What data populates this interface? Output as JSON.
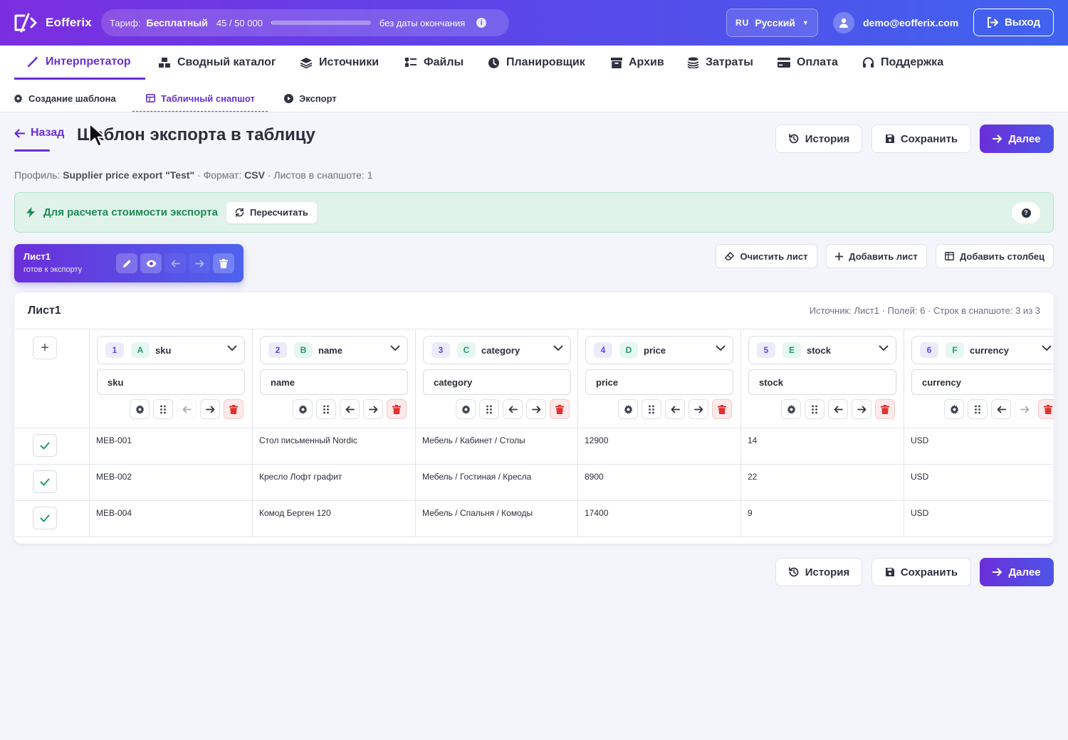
{
  "app": {
    "name": "Eofferix",
    "tariff_label": "Тариф:",
    "tariff_plan": "Бесплатный",
    "tariff_quota": "45 / 50 000",
    "tariff_usage_fraction": 0.0009,
    "tariff_expiry": "без даты окончания",
    "lang_code": "RU",
    "lang_name": "Русский",
    "user_email": "demo@eofferix.com",
    "logout": "Выход"
  },
  "nav": {
    "items": [
      {
        "label": "Интерпретатор",
        "icon": "magic-wand-icon"
      },
      {
        "label": "Сводный каталог",
        "icon": "boxes-icon"
      },
      {
        "label": "Источники",
        "icon": "layers-icon"
      },
      {
        "label": "Файлы",
        "icon": "files-icon"
      },
      {
        "label": "Планировщик",
        "icon": "clock-icon"
      },
      {
        "label": "Архив",
        "icon": "archive-icon"
      },
      {
        "label": "Затраты",
        "icon": "coins-icon"
      },
      {
        "label": "Оплата",
        "icon": "credit-card-icon"
      },
      {
        "label": "Поддержка",
        "icon": "headset-icon"
      }
    ],
    "active_index": 0,
    "sub": [
      {
        "label": "Создание шаблона",
        "icon": "gear-icon"
      },
      {
        "label": "Табличный снапшот",
        "icon": "table-icon"
      },
      {
        "label": "Экспорт",
        "icon": "play-circle-icon"
      }
    ],
    "active_sub_index": 1
  },
  "page": {
    "back": "Назад",
    "title": "Шаблон экспорта в таблицу",
    "history": "История",
    "save": "Сохранить",
    "next": "Далее",
    "meta_profile_label": "Профиль:",
    "meta_profile": "Supplier price export \"Test\"",
    "meta_format_label": "· Формат:",
    "meta_format": "CSV",
    "meta_sheets": "· Листов в снапшоте: 1"
  },
  "alert": {
    "text": "Для расчета стоимости экспорта",
    "recalc": "Пересчитать",
    "color": "#1f8a55"
  },
  "sheet_tab": {
    "name": "Лист1",
    "status": "готов к экспорту"
  },
  "sheet_actions": {
    "clear": "Очистить лист",
    "add_sheet": "Добавить лист",
    "add_column": "Добавить столбец"
  },
  "table": {
    "title": "Лист1",
    "meta": "Источник: Лист1 · Полей: 6 · Строк в снапшоте: 3 из 3",
    "columns": [
      {
        "num": "1",
        "letter": "A",
        "field": "sku",
        "header": "sku"
      },
      {
        "num": "2",
        "letter": "B",
        "field": "name",
        "header": "name"
      },
      {
        "num": "3",
        "letter": "C",
        "field": "category",
        "header": "category"
      },
      {
        "num": "4",
        "letter": "D",
        "field": "price",
        "header": "price"
      },
      {
        "num": "5",
        "letter": "E",
        "field": "stock",
        "header": "stock"
      },
      {
        "num": "6",
        "letter": "F",
        "field": "currency",
        "header": "currency"
      }
    ],
    "rows": [
      [
        "MEB-001",
        "Стол письменный Nordic",
        "Мебель / Кабинет / Столы",
        "12900",
        "14",
        "USD"
      ],
      [
        "MEB-002",
        "Кресло Лофт графит",
        "Мебель / Гостиная / Кресла",
        "8900",
        "22",
        "USD"
      ],
      [
        "MEB-004",
        "Комод Берген 120",
        "Мебель / Спальня / Комоды",
        "17400",
        "9",
        "USD"
      ]
    ]
  },
  "colors": {
    "accent": "#6a2fd9",
    "accent2": "#4e54e8",
    "success": "#1f9a6a",
    "danger": "#e03131"
  }
}
